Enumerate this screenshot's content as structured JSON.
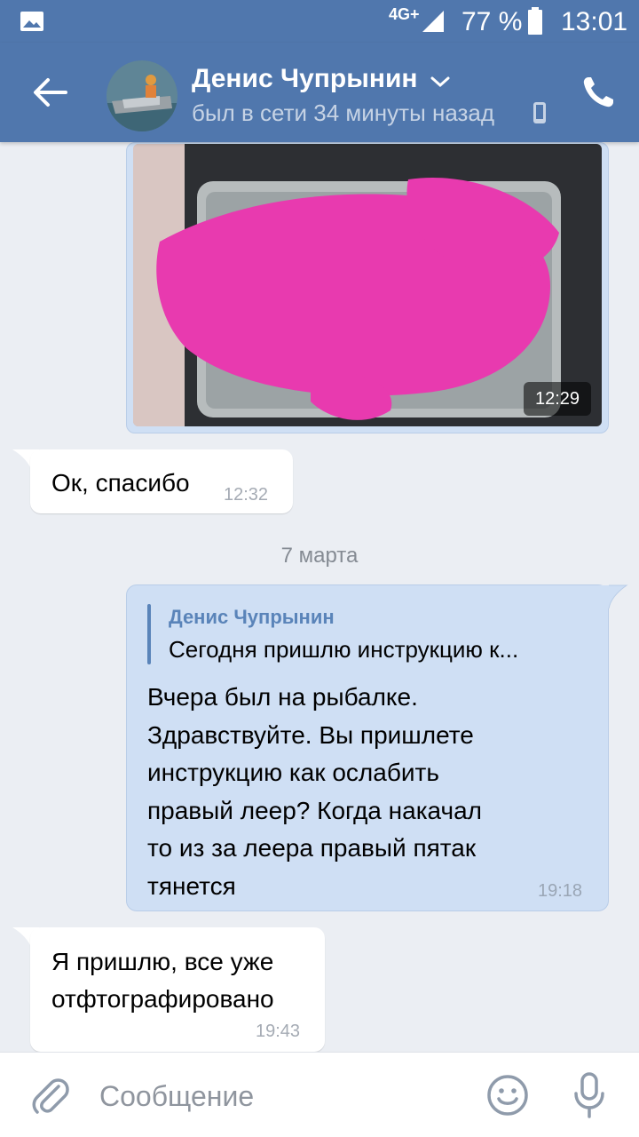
{
  "status_bar": {
    "network": "4G+",
    "battery_percent": "77 %",
    "time": "13:01"
  },
  "header": {
    "contact_name": "Денис Чупрынин",
    "last_seen": "был в сети 34 минуты назад"
  },
  "messages": [
    {
      "type": "photo",
      "direction": "outgoing",
      "time": "12:29"
    },
    {
      "type": "text",
      "direction": "incoming",
      "text": "Ок, спасибо",
      "time": "12:32"
    },
    {
      "type": "date",
      "text": "7 марта"
    },
    {
      "type": "text",
      "direction": "outgoing",
      "reply": {
        "author": "Денис Чупрынин",
        "text": "Сегодня пришлю инструкцию к..."
      },
      "lines": [
        "Вчера был на рыбалке.",
        "Здравствуйте. Вы пришлете",
        "инструкцию как ослабить",
        "правый леер? Когда накачал",
        "то из за леера правый пятак",
        "тянется"
      ],
      "time": "19:18"
    },
    {
      "type": "text",
      "direction": "incoming",
      "lines": [
        "Я пришлю, все уже",
        "отфтографировано"
      ],
      "time": "19:43"
    }
  ],
  "composer": {
    "placeholder": "Сообщение"
  },
  "colors": {
    "header_bg": "#5077ad",
    "chat_bg": "#ebeef3",
    "outgoing_bubble": "#cfdff4",
    "incoming_bubble": "#ffffff",
    "accent": "#5a84b9"
  },
  "icons": [
    "gallery-icon",
    "signal-icon",
    "battery-icon",
    "back-arrow-icon",
    "chevron-down-icon",
    "mobile-device-icon",
    "phone-icon",
    "paperclip-icon",
    "emoji-icon",
    "microphone-icon"
  ]
}
